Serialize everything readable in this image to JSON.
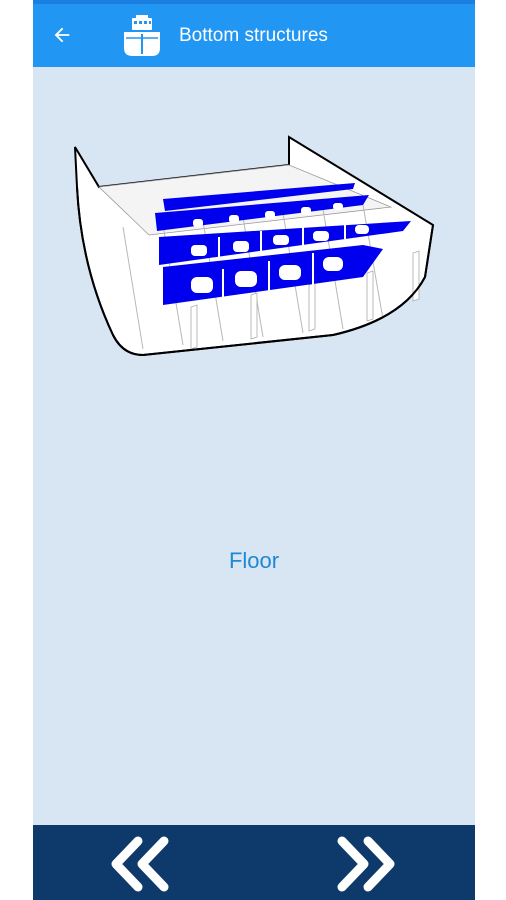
{
  "app_bar": {
    "title": "Bottom structures",
    "back_icon": "arrow-left-icon",
    "logo_icon": "ship-icon",
    "color": "#2196f3"
  },
  "content": {
    "figure_icon": "hull-cross-section-illustration",
    "caption": "Floor",
    "caption_color": "#1e88d4",
    "background": "#d8e6f3",
    "highlight_color": "#0000ff"
  },
  "bottom_bar": {
    "color": "#0d3a6b",
    "prev_icon": "double-chevron-left-icon",
    "next_icon": "double-chevron-right-icon"
  }
}
